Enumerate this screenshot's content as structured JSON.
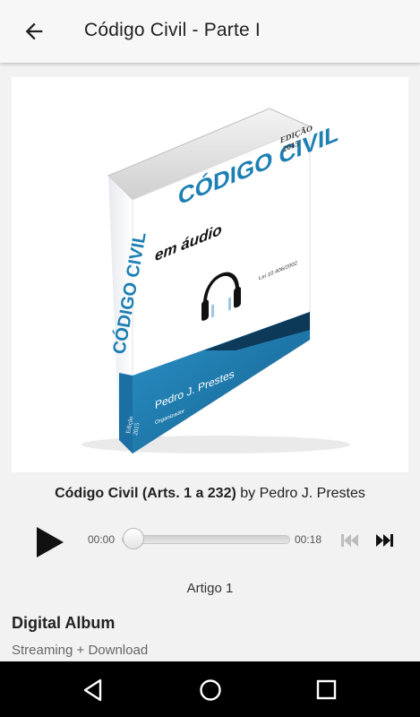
{
  "app_bar": {
    "title": "Código Civil - Parte I",
    "back_icon": "arrow-back-icon"
  },
  "cover": {
    "book_title": "CÓDIGO CIVIL",
    "spine_title": "CÓDIGO CIVIL",
    "subtitle": "em áudio",
    "edition": "EDIÇÃO",
    "edition_year": "2015",
    "law": "Lei 10.406/2002",
    "author": "Pedro J. Prestes",
    "role": "Organizador",
    "spine_label": "Edição",
    "spine_year": "2015",
    "accent_color": "#1d7fb4"
  },
  "track": {
    "title": "Código Civil (Arts. 1 a 232)",
    "by": "by",
    "artist": "Pedro J. Prestes",
    "current_time": "00:00",
    "total_time": "00:18",
    "progress": 0.0,
    "name": "Artigo 1"
  },
  "album": {
    "title": "Digital Album",
    "subtitle": "Streaming + Download"
  },
  "nav_bar": {
    "back_icon": "nav-back-icon",
    "home_icon": "nav-home-icon",
    "recents_icon": "nav-recents-icon"
  }
}
